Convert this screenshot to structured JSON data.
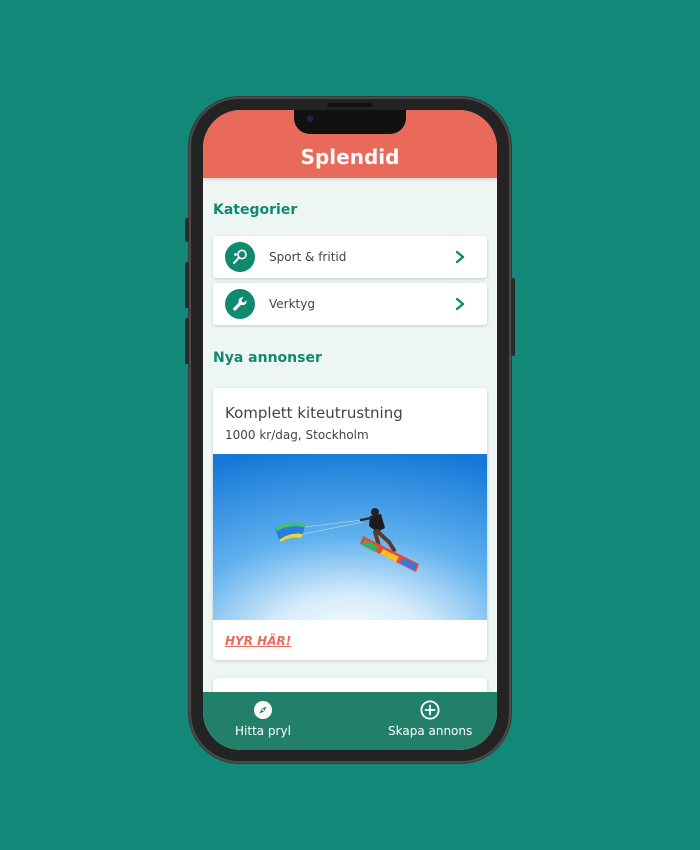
{
  "app": {
    "title": "Splendid",
    "accent_color": "#e96a5a",
    "primary_color": "#108a6e",
    "background_color": "#118878"
  },
  "categories": {
    "title": "Kategorier",
    "items": [
      {
        "label": "Sport & fritid",
        "icon": "racket-icon"
      },
      {
        "label": "Verktyg",
        "icon": "wrench-icon"
      }
    ]
  },
  "new_ads": {
    "title": "Nya annonser",
    "items": [
      {
        "title": "Komplett kiteutrustning",
        "subtitle": "1000 kr/dag, Stockholm",
        "image": "kitesurfer-photo",
        "cta": "HYR HÄR!"
      }
    ]
  },
  "bottom_nav": {
    "items": [
      {
        "label": "Hitta pryl",
        "icon": "compass-icon"
      },
      {
        "label": "Skapa annons",
        "icon": "plus-circle-icon"
      }
    ]
  }
}
